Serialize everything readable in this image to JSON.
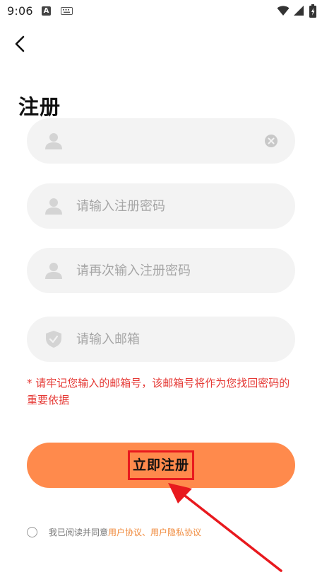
{
  "status_bar": {
    "time": "9:06",
    "a_icon_text": "A",
    "icons": [
      "a-icon",
      "keyboard-icon",
      "wifi-icon",
      "signal-icon",
      "battery-icon"
    ]
  },
  "header": {
    "back_icon": "chevron-left-icon",
    "title": "注册"
  },
  "form": {
    "username": {
      "value": "",
      "placeholder": "",
      "icon": "user-icon",
      "clear_icon": "clear-icon"
    },
    "password": {
      "value": "",
      "placeholder": "请输入注册密码",
      "icon": "user-icon"
    },
    "confirm_password": {
      "value": "",
      "placeholder": "请再次输入注册密码",
      "icon": "user-icon"
    },
    "email": {
      "value": "",
      "placeholder": "请输入邮箱",
      "icon": "shield-check-icon"
    }
  },
  "hint_text": "* 请牢记您输入的邮箱号，该邮箱号将作为您找回密码的重要依据",
  "register_button": {
    "label": "立即注册"
  },
  "agreement": {
    "prefix": "我已阅读并同意 ",
    "user_agreement": "用户协议",
    "separator": "、",
    "privacy_agreement": "用户隐私协议"
  },
  "colors": {
    "accent": "#ff8a4c",
    "field_bg": "#f3f3f3",
    "hint": "#e53935",
    "link": "#f08a3c",
    "annotation": "#e8191e"
  }
}
